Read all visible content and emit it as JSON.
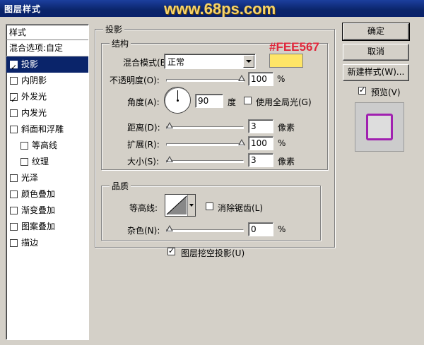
{
  "window": {
    "title": "图层样式",
    "watermark": "www.68ps.com"
  },
  "styles_panel": {
    "header": "样式",
    "blend_options": "混合选项:自定",
    "items": [
      {
        "label": "投影",
        "checked": true,
        "selected": true,
        "indent": false
      },
      {
        "label": "内阴影",
        "checked": false,
        "selected": false,
        "indent": false
      },
      {
        "label": "外发光",
        "checked": true,
        "selected": false,
        "indent": false
      },
      {
        "label": "内发光",
        "checked": false,
        "selected": false,
        "indent": false
      },
      {
        "label": "斜面和浮雕",
        "checked": false,
        "selected": false,
        "indent": false
      },
      {
        "label": "等高线",
        "checked": false,
        "selected": false,
        "indent": true
      },
      {
        "label": "纹理",
        "checked": false,
        "selected": false,
        "indent": true
      },
      {
        "label": "光泽",
        "checked": false,
        "selected": false,
        "indent": false
      },
      {
        "label": "颜色叠加",
        "checked": false,
        "selected": false,
        "indent": false
      },
      {
        "label": "渐变叠加",
        "checked": false,
        "selected": false,
        "indent": false
      },
      {
        "label": "图案叠加",
        "checked": false,
        "selected": false,
        "indent": false
      },
      {
        "label": "描边",
        "checked": false,
        "selected": false,
        "indent": false
      }
    ]
  },
  "drop_shadow": {
    "section_title": "投影",
    "structure": {
      "title": "结构",
      "blend_mode_label": "混合模式(B):",
      "blend_mode_value": "正常",
      "color_hex_annotation": "#FEE567",
      "swatch_color": "#FEE567",
      "opacity_label": "不透明度(O):",
      "opacity_value": "100",
      "opacity_unit": "%",
      "angle_label": "角度(A):",
      "angle_value": "90",
      "angle_unit": "度",
      "global_light_label": "使用全局光(G)",
      "global_light_checked": false,
      "distance_label": "距离(D):",
      "distance_value": "3",
      "distance_unit": "像素",
      "spread_label": "扩展(R):",
      "spread_value": "100",
      "spread_unit": "%",
      "size_label": "大小(S):",
      "size_value": "3",
      "size_unit": "像素"
    },
    "quality": {
      "title": "品质",
      "contour_label": "等高线:",
      "antialias_label": "消除锯齿(L)",
      "antialias_checked": false,
      "noise_label": "杂色(N):",
      "noise_value": "0",
      "noise_unit": "%"
    },
    "knockout_label": "图层挖空投影(U)",
    "knockout_checked": true
  },
  "buttons": {
    "ok": "确定",
    "cancel": "取消",
    "new_style": "新建样式(W)...",
    "preview_label": "预览(V)",
    "preview_checked": true
  },
  "colors": {
    "selection": "#0a246a",
    "preview_border": "#a020b0"
  }
}
